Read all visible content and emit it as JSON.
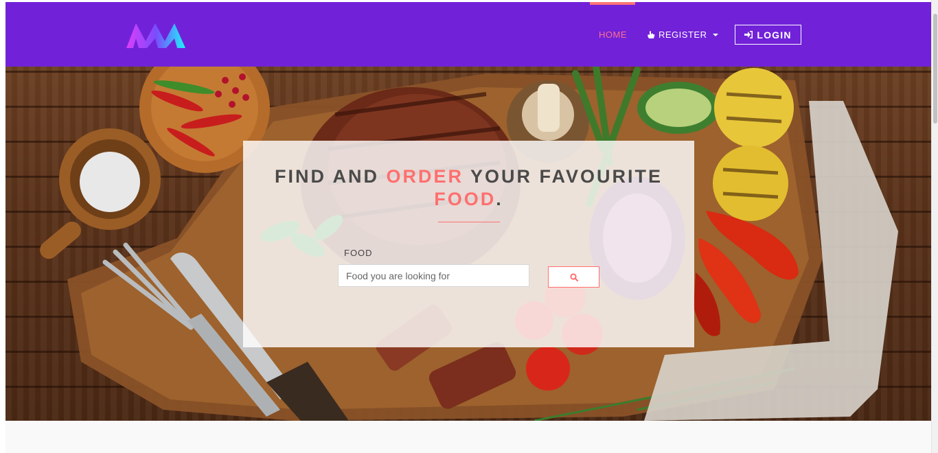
{
  "navbar": {
    "home_label": "HOME",
    "register_label": "REGISTER",
    "login_label": "LOGIN",
    "background_color": "#7122d8",
    "active_color": "#ff6f8f"
  },
  "hero": {
    "headline_part1": "FIND AND",
    "headline_accent1": "ORDER",
    "headline_part2": "YOUR FAVOURITE",
    "headline_accent2": "FOOD",
    "headline_end": ".",
    "accent_color": "#ff6f6f",
    "search_label": "FOOD",
    "search_placeholder": "Food you are looking for",
    "search_icon": "search-icon"
  },
  "icons": {
    "logo": "logo-icon",
    "register": "hand-icon",
    "login": "sign-in-icon",
    "dropdown": "caret-down-icon"
  }
}
